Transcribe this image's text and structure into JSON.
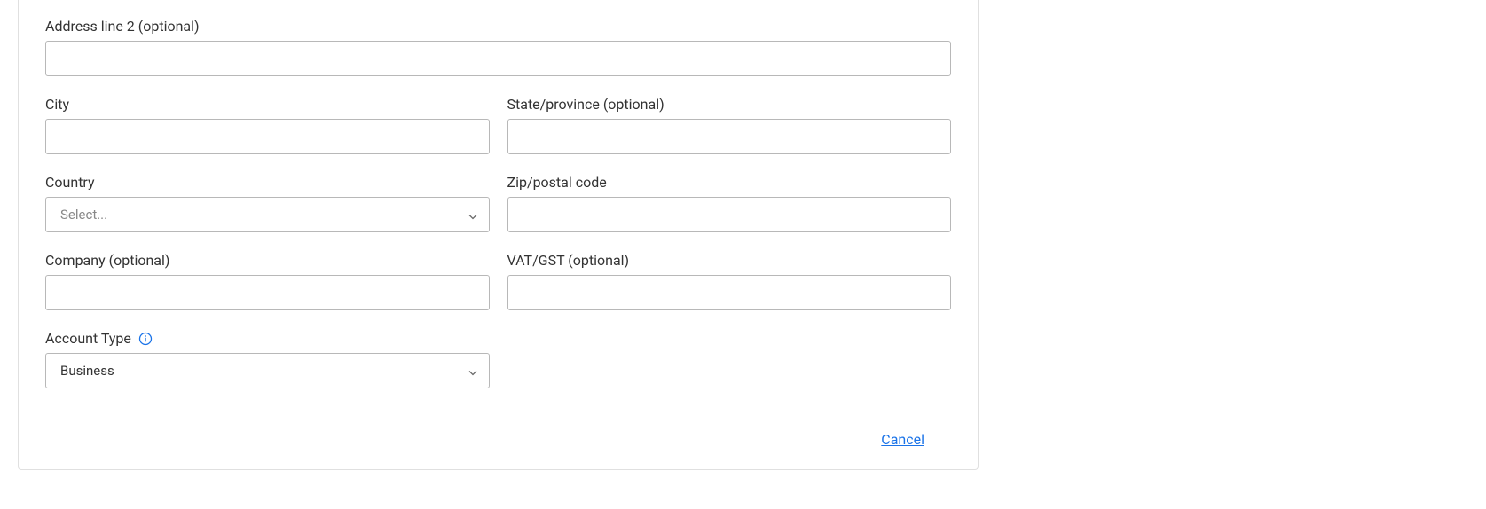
{
  "fields": {
    "address2": {
      "label": "Address line 2 (optional)",
      "value": ""
    },
    "city": {
      "label": "City",
      "value": ""
    },
    "state": {
      "label": "State/province (optional)",
      "value": ""
    },
    "country": {
      "label": "Country",
      "placeholder": "Select...",
      "selected": ""
    },
    "zip": {
      "label": "Zip/postal code",
      "value": ""
    },
    "company": {
      "label": "Company (optional)",
      "value": ""
    },
    "vat": {
      "label": "VAT/GST (optional)",
      "value": ""
    },
    "account_type": {
      "label": "Account Type",
      "selected": "Business"
    }
  },
  "actions": {
    "cancel": "Cancel"
  }
}
